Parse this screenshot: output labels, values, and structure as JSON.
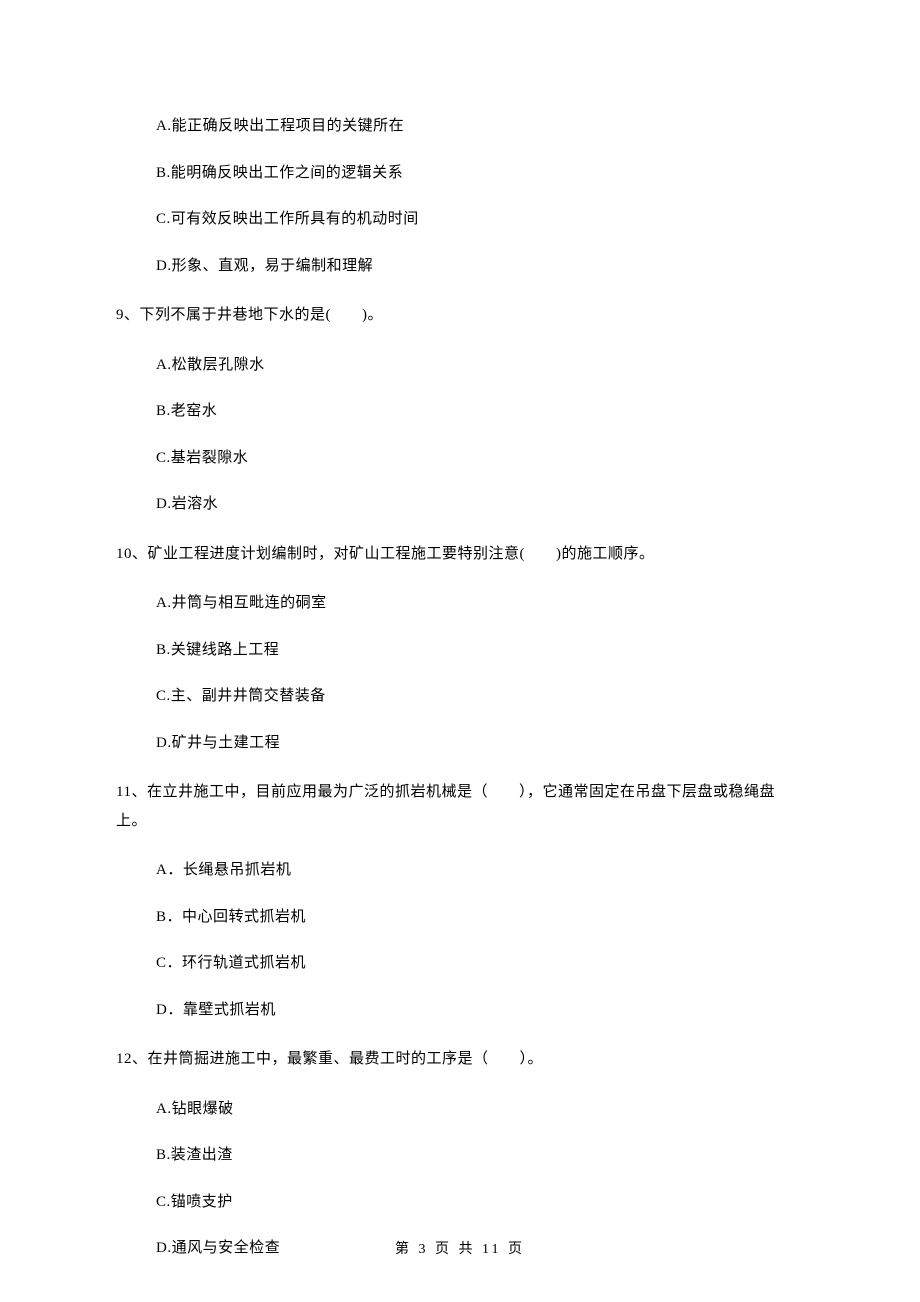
{
  "prev_options": {
    "a": "A.能正确反映出工程项目的关键所在",
    "b": "B.能明确反映出工作之间的逻辑关系",
    "c": "C.可有效反映出工作所具有的机动时间",
    "d": "D.形象、直观，易于编制和理解"
  },
  "q9": {
    "stem": "9、下列不属于井巷地下水的是(　　)。",
    "a": "A.松散层孔隙水",
    "b": "B.老窑水",
    "c": "C.基岩裂隙水",
    "d": "D.岩溶水"
  },
  "q10": {
    "stem": "10、矿业工程进度计划编制时，对矿山工程施工要特别注意(　　)的施工顺序。",
    "a": "A.井筒与相互毗连的硐室",
    "b": "B.关键线路上工程",
    "c": "C.主、副井井筒交替装备",
    "d": "D.矿井与土建工程"
  },
  "q11": {
    "stem": "11、在立井施工中，目前应用最为广泛的抓岩机械是（　　），它通常固定在吊盘下层盘或稳绳盘上。",
    "a": "A．长绳悬吊抓岩机",
    "b": "B．中心回转式抓岩机",
    "c": "C．环行轨道式抓岩机",
    "d": "D．靠壁式抓岩机"
  },
  "q12": {
    "stem": "12、在井筒掘进施工中，最繁重、最费工时的工序是（　　）。",
    "a": "A.钻眼爆破",
    "b": "B.装渣出渣",
    "c": "C.锚喷支护",
    "d": "D.通风与安全检查"
  },
  "footer": "第 3 页 共 11 页"
}
